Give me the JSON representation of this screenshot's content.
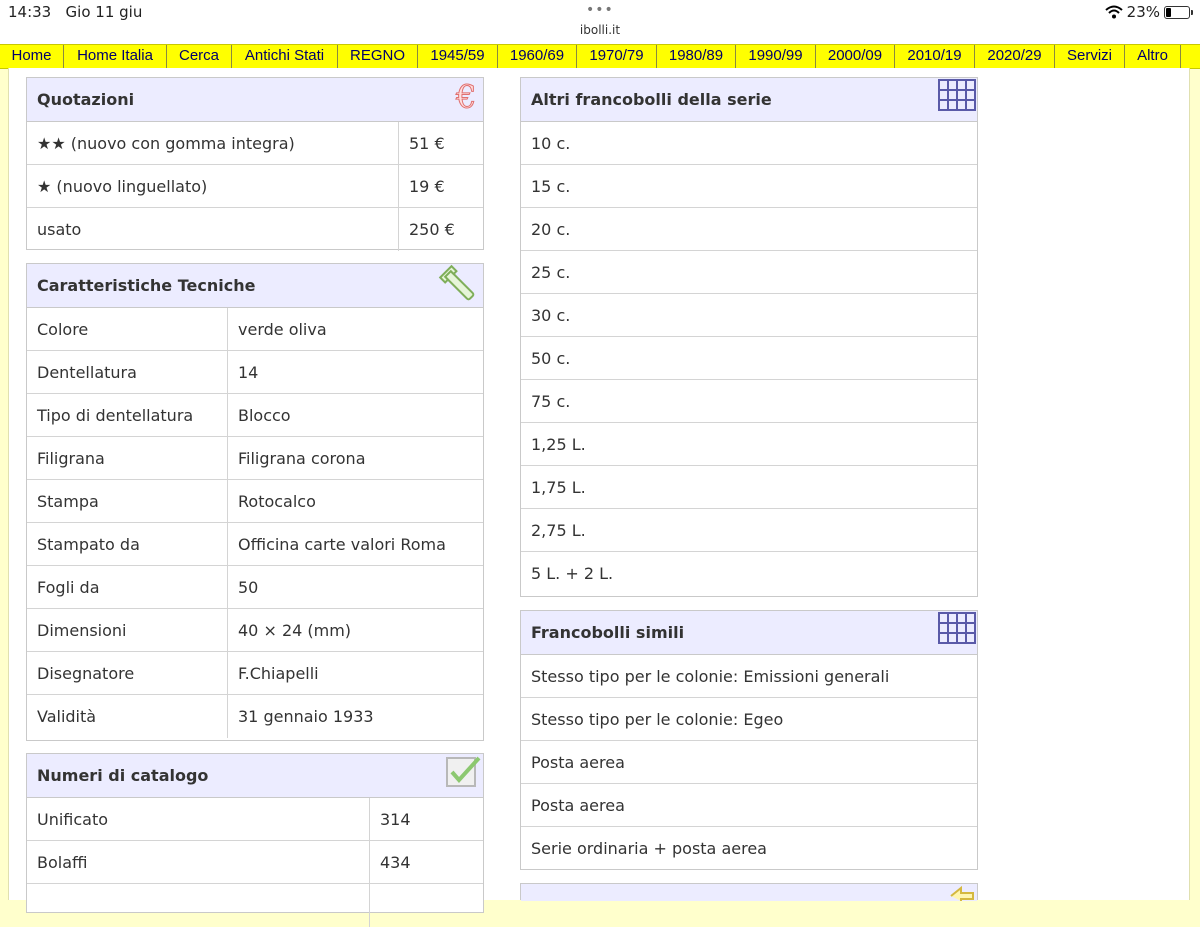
{
  "status": {
    "time": "14:33",
    "date": "Gio 11 giu",
    "dots": "•••",
    "url": "ibolli.it",
    "battery": "23%"
  },
  "nav": [
    {
      "label": "Home"
    },
    {
      "label": "Home Italia"
    },
    {
      "label": "Cerca"
    },
    {
      "label": "Antichi Stati"
    },
    {
      "label": "REGNO"
    },
    {
      "label": "1945/59"
    },
    {
      "label": "1960/69"
    },
    {
      "label": "1970/79"
    },
    {
      "label": "1980/89"
    },
    {
      "label": "1990/99"
    },
    {
      "label": "2000/09"
    },
    {
      "label": "2010/19"
    },
    {
      "label": "2020/29"
    },
    {
      "label": "Servizi"
    },
    {
      "label": "Altro"
    }
  ],
  "quotazioni": {
    "title": "Quotazioni",
    "icon": "euro-icon",
    "rows": [
      {
        "k": "★★ (nuovo con gomma integra)",
        "v": "51 €"
      },
      {
        "k": "★ (nuovo linguellato)",
        "v": "19 €"
      },
      {
        "k": "usato",
        "v": "250 €"
      }
    ]
  },
  "caratteristiche": {
    "title": "Caratteristiche Tecniche",
    "icon": "wrench-icon",
    "rows": [
      {
        "k": "Colore",
        "v": "verde oliva"
      },
      {
        "k": "Dentellatura",
        "v": "14"
      },
      {
        "k": "Tipo di dentellatura",
        "v": "Blocco"
      },
      {
        "k": "Filigrana",
        "v": "Filigrana corona"
      },
      {
        "k": "Stampa",
        "v": "Rotocalco"
      },
      {
        "k": "Stampato da",
        "v": "Officina carte valori Roma"
      },
      {
        "k": "Fogli da",
        "v": "50"
      },
      {
        "k": "Dimensioni",
        "v": "40 × 24 (mm)"
      },
      {
        "k": "Disegnatore",
        "v": "F.Chiapelli"
      },
      {
        "k": "Validità",
        "v": "31 gennaio 1933"
      }
    ]
  },
  "catalogo": {
    "title": "Numeri di catalogo",
    "icon": "checkbox-icon",
    "rows": [
      {
        "k": "Unificato",
        "v": "314"
      },
      {
        "k": "Bolaffi",
        "v": "434"
      }
    ]
  },
  "serie": {
    "title": "Altri francobolli della serie",
    "icon": "grid-icon",
    "items": [
      "10 c.",
      "15 c.",
      "20 c.",
      "25 c.",
      "30 c.",
      "50 c.",
      "75 c.",
      "1,25 L.",
      "1,75 L.",
      "2,75 L.",
      "5 L. + 2 L."
    ]
  },
  "simili": {
    "title": "Francobolli simili",
    "icon": "grid-icon",
    "items": [
      "Stesso tipo per le colonie: Emissioni generali",
      "Stesso tipo per le colonie: Egeo",
      "Posta aerea",
      "Posta aerea",
      "Serie ordinaria + posta aerea"
    ]
  },
  "next_box": {
    "icon": "arrow-left-icon"
  },
  "colors": {
    "nav_bg": "#ffff00",
    "nav_text": "#00006a",
    "page_bg": "#ffffcc",
    "header_bg": "#ececff"
  }
}
